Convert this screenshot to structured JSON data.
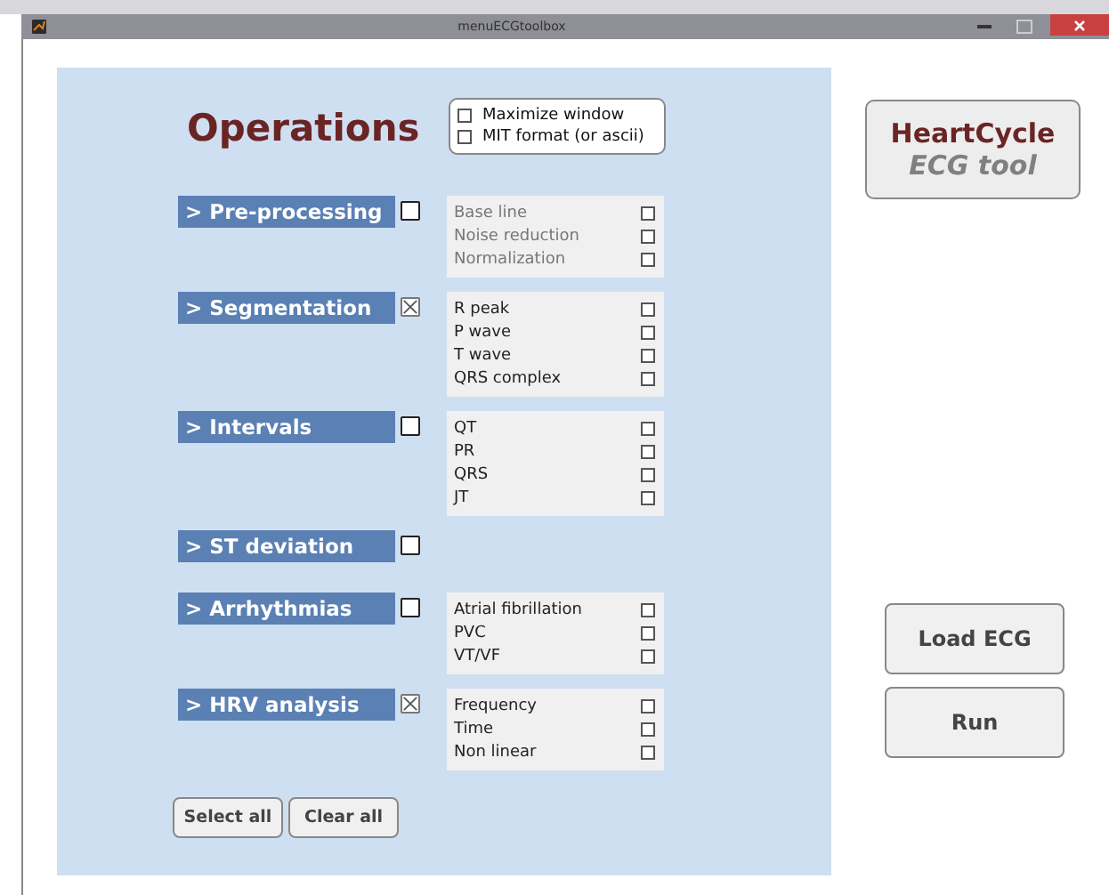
{
  "window": {
    "title": "menuECGtoolbox"
  },
  "heading": "Operations",
  "top_options": [
    {
      "label": "Maximize window",
      "checked": false
    },
    {
      "label": "MIT format (or ascii)",
      "checked": false
    }
  ],
  "sections": [
    {
      "label": "> Pre-processing",
      "checked": false,
      "options": [
        {
          "label": "Base line",
          "checked": false,
          "disabled": true
        },
        {
          "label": "Noise reduction",
          "checked": false,
          "disabled": true
        },
        {
          "label": "Normalization",
          "checked": false,
          "disabled": true
        }
      ]
    },
    {
      "label": "> Segmentation",
      "checked": true,
      "options": [
        {
          "label": "R peak",
          "checked": false,
          "disabled": false
        },
        {
          "label": "P wave",
          "checked": false,
          "disabled": false
        },
        {
          "label": "T wave",
          "checked": false,
          "disabled": false
        },
        {
          "label": "QRS complex",
          "checked": false,
          "disabled": false
        }
      ]
    },
    {
      "label": "> Intervals",
      "checked": false,
      "options": [
        {
          "label": "QT",
          "checked": false,
          "disabled": false
        },
        {
          "label": "PR",
          "checked": false,
          "disabled": false
        },
        {
          "label": "QRS",
          "checked": false,
          "disabled": false
        },
        {
          "label": "JT",
          "checked": false,
          "disabled": false
        }
      ]
    },
    {
      "label": "> ST deviation",
      "checked": false
    },
    {
      "label": "> Arrhythmias",
      "checked": false,
      "options": [
        {
          "label": "Atrial fibrillation",
          "checked": false,
          "disabled": false
        },
        {
          "label": "PVC",
          "checked": false,
          "disabled": false
        },
        {
          "label": "VT/VF",
          "checked": false,
          "disabled": false
        }
      ]
    },
    {
      "label": "> HRV analysis",
      "checked": true,
      "options": [
        {
          "label": "Frequency",
          "checked": false,
          "disabled": false
        },
        {
          "label": "Time",
          "checked": false,
          "disabled": false
        },
        {
          "label": "Non linear",
          "checked": false,
          "disabled": false
        }
      ]
    }
  ],
  "panel_buttons": [
    "Select all",
    "Clear all"
  ],
  "brand": {
    "name": "HeartCycle",
    "subtitle": "ECG tool"
  },
  "side_buttons": [
    "Load ECG",
    "Run"
  ]
}
